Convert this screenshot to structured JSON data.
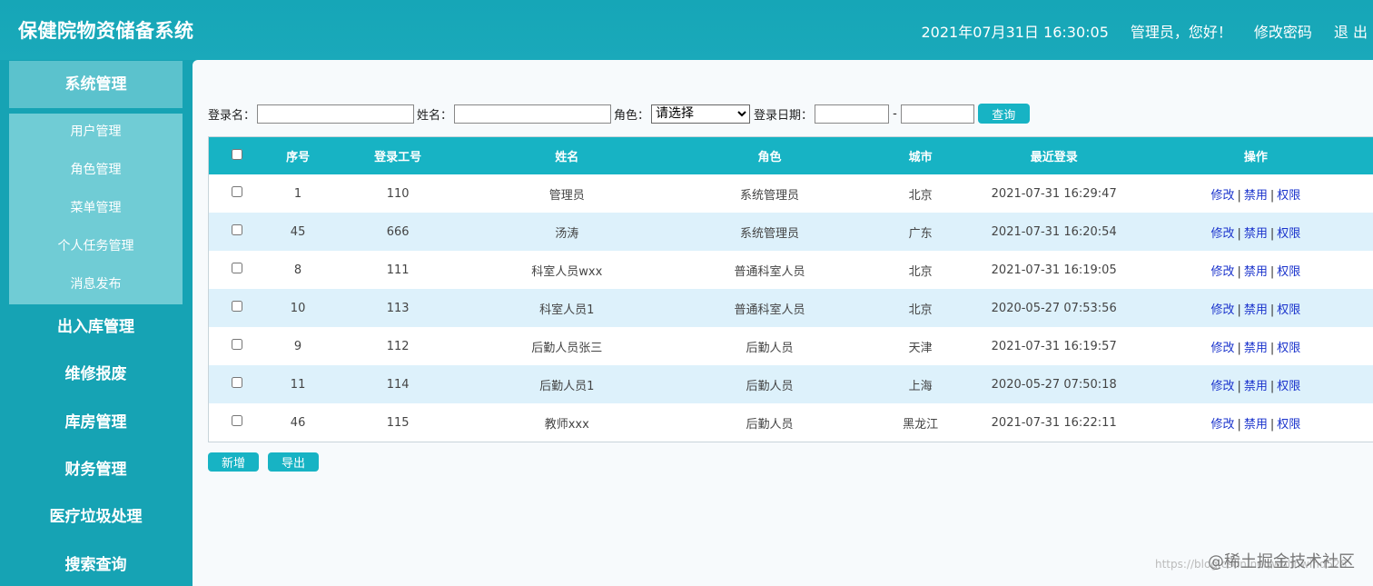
{
  "header": {
    "title": "保健院物资储备系统",
    "datetime": "2021年07月31日 16:30:05",
    "greeting": "管理员，您好！",
    "change_password": "修改密码",
    "logout": "退 出"
  },
  "sidebar": {
    "system_mgmt": "系统管理",
    "sub_items": [
      "用户管理",
      "角色管理",
      "菜单管理",
      "个人任务管理",
      "消息发布"
    ],
    "menus": [
      "出入库管理",
      "维修报废",
      "库房管理",
      "财务管理",
      "医疗垃圾处理",
      "搜索查询"
    ]
  },
  "filter": {
    "login_name_label": "登录名：",
    "name_label": "姓名：",
    "role_label": "角色：",
    "role_selected": "请选择",
    "date_label": "登录日期：",
    "date_sep": "-",
    "query_button": "查询"
  },
  "table": {
    "headers": [
      "序号",
      "登录工号",
      "姓名",
      "角色",
      "城市",
      "最近登录",
      "操作"
    ],
    "rows": [
      {
        "no": "1",
        "login_id": "110",
        "name": "管理员",
        "role": "系统管理员",
        "city": "北京",
        "last_login": "2021-07-31 16:29:47"
      },
      {
        "no": "45",
        "login_id": "666",
        "name": "汤涛",
        "role": "系统管理员",
        "city": "广东",
        "last_login": "2021-07-31 16:20:54"
      },
      {
        "no": "8",
        "login_id": "111",
        "name": "科室人员wxx",
        "role": "普通科室人员",
        "city": "北京",
        "last_login": "2021-07-31 16:19:05"
      },
      {
        "no": "10",
        "login_id": "113",
        "name": "科室人员1",
        "role": "普通科室人员",
        "city": "北京",
        "last_login": "2020-05-27 07:53:56"
      },
      {
        "no": "9",
        "login_id": "112",
        "name": "后勤人员张三",
        "role": "后勤人员",
        "city": "天津",
        "last_login": "2021-07-31 16:19:57"
      },
      {
        "no": "11",
        "login_id": "114",
        "name": "后勤人员1",
        "role": "后勤人员",
        "city": "上海",
        "last_login": "2020-05-27 07:50:18"
      },
      {
        "no": "46",
        "login_id": "115",
        "name": "教师xxx",
        "role": "后勤人员",
        "city": "黑龙江",
        "last_login": "2021-07-31 16:22:11"
      }
    ],
    "ops": {
      "edit": "修改",
      "disable": "禁用",
      "perm": "权限",
      "sep": "|"
    }
  },
  "actions": {
    "add": "新增",
    "export": "导出"
  },
  "watermark": {
    "url": "https://blog.csdn.net/whlinwind528",
    "community": "@稀土掘金技术社区"
  },
  "colors": {
    "primary": "#17b3c4",
    "header": "#16a6b7",
    "alt_row": "#ddf1fb",
    "link": "#1a33cc"
  }
}
